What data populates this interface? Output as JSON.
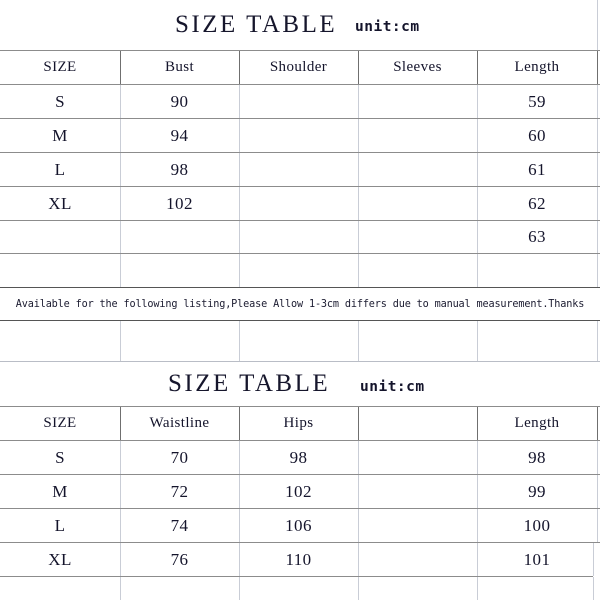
{
  "page": {
    "background": "#ffffff",
    "border_color": "#8c8c8c",
    "text_color": "#14142b"
  },
  "tables": [
    {
      "title": "SIZE TABLE",
      "unit": "unit:cm",
      "columns": [
        "SIZE",
        "Bust",
        "Shoulder",
        "Sleeves",
        "Length"
      ],
      "rows": [
        [
          "S",
          "90",
          "",
          "",
          "59"
        ],
        [
          "M",
          "94",
          "",
          "",
          "60"
        ],
        [
          "L",
          "98",
          "",
          "",
          "61"
        ],
        [
          "XL",
          "102",
          "",
          "",
          "62"
        ],
        [
          "",
          "",
          "",
          "",
          "63"
        ],
        [
          "",
          "",
          "",
          "",
          ""
        ]
      ],
      "note": "Available for the following listing,Please Allow 1-3cm differs due to manual measurement.Thanks"
    },
    {
      "title": "SIZE TABLE",
      "unit": "unit:cm",
      "columns": [
        "SIZE",
        "Waistline",
        "Hips",
        "",
        "Length"
      ],
      "rows": [
        [
          "S",
          "70",
          "98",
          "",
          "98"
        ],
        [
          "M",
          "72",
          "102",
          "",
          "99"
        ],
        [
          "L",
          "74",
          "106",
          "",
          "100"
        ],
        [
          "XL",
          "76",
          "110",
          "",
          "101"
        ],
        [
          "",
          "",
          "",
          "",
          ""
        ]
      ]
    }
  ]
}
